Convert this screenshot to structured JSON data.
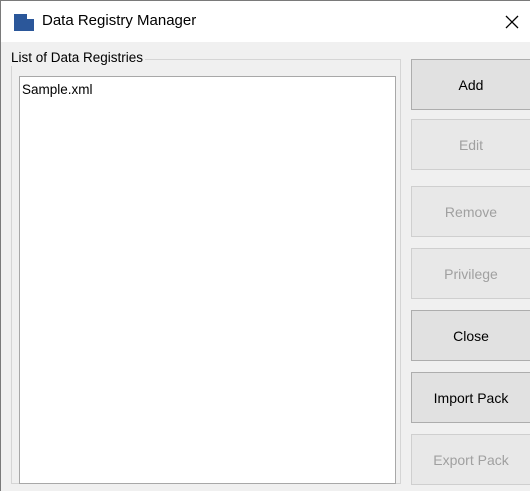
{
  "window": {
    "title": "Data Registry Manager",
    "close_glyph": "×"
  },
  "list": {
    "group_label": "List of Data Registries",
    "items": [
      "Sample.xml"
    ]
  },
  "buttons": {
    "add": "Add",
    "edit": "Edit",
    "remove": "Remove",
    "privilege": "Privilege",
    "close": "Close",
    "import_pack": "Import Pack",
    "export_pack": "Export Pack"
  },
  "colors": {
    "enabled_text": "#000000",
    "disabled_text": "#a0a0a0",
    "icon_blue": "#2b579a"
  }
}
